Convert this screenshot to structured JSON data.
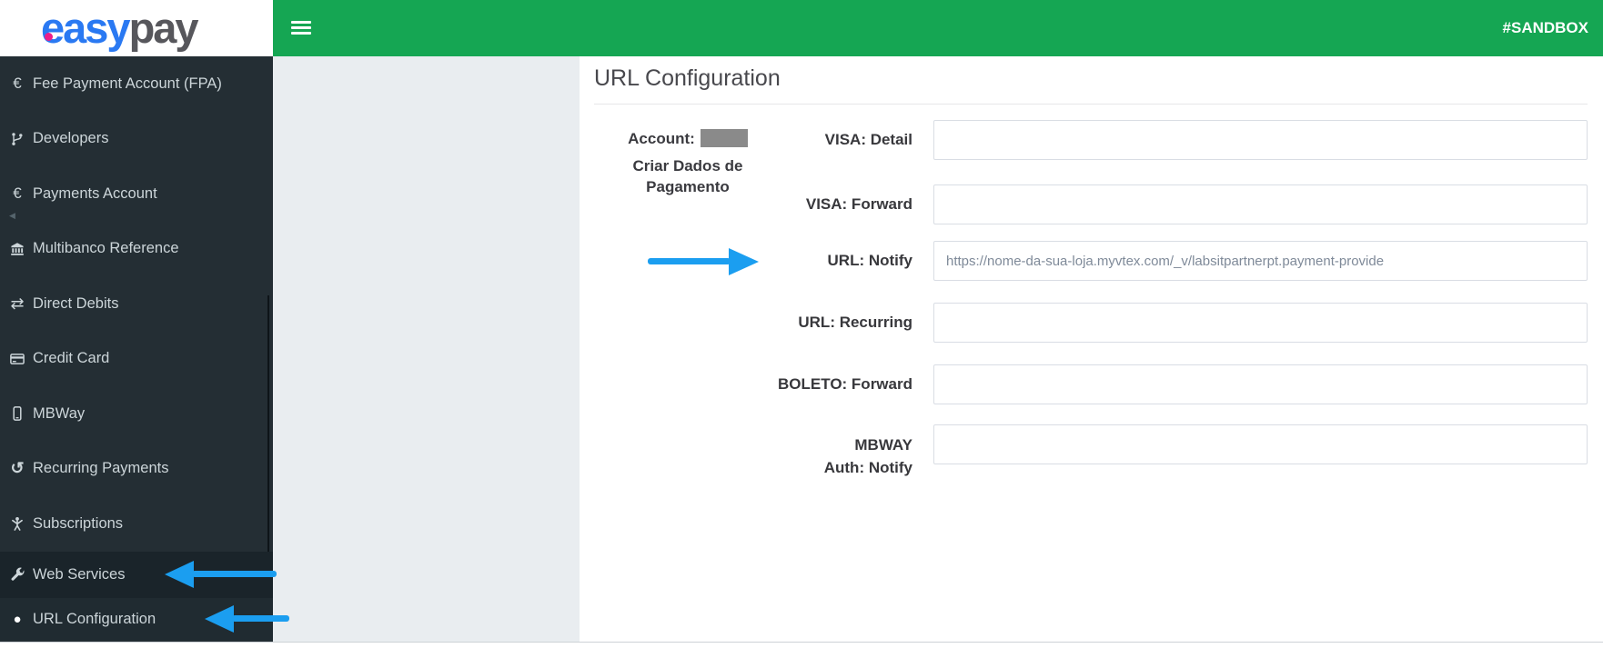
{
  "header": {
    "logo_easy": "easy",
    "logo_pay": "pay",
    "env_badge": "#SANDBOX"
  },
  "sidebar": {
    "items": [
      {
        "icon": "euro-icon",
        "label": "Fee Payment Account (FPA)"
      },
      {
        "icon": "git-branch-icon",
        "label": "Developers"
      },
      {
        "icon": "euro-icon",
        "label": "Payments Account",
        "collapse_caret": "◀"
      },
      {
        "icon": "bank-icon",
        "label": "Multibanco Reference"
      },
      {
        "icon": "transfer-icon",
        "label": "Direct Debits"
      },
      {
        "icon": "credit-card-icon",
        "label": "Credit Card"
      },
      {
        "icon": "mobile-icon",
        "label": "MBWay"
      },
      {
        "icon": "history-icon",
        "label": "Recurring Payments"
      },
      {
        "icon": "person-icon",
        "label": "Subscriptions"
      },
      {
        "icon": "wrench-icon",
        "label": "Web Services",
        "active": true
      },
      {
        "icon": "circle-icon",
        "label": "URL Configuration",
        "active": true
      }
    ],
    "glyphs": {
      "euro": "€",
      "transfer": "⇄",
      "history": "↺",
      "circle": "●",
      "caret": "◀"
    }
  },
  "main": {
    "title": "URL Configuration",
    "account": {
      "label": "Account:",
      "description": "Criar Dados de Pagamento"
    },
    "form": {
      "rows": [
        {
          "label": "VISA: Detail",
          "value": ""
        },
        {
          "label": "VISA: Forward",
          "value": ""
        },
        {
          "label": "URL: Notify",
          "value": "https://nome-da-sua-loja.myvtex.com/_v/labsitpartnerpt.payment-provide"
        },
        {
          "label": "URL: Recurring",
          "value": ""
        },
        {
          "label": "BOLETO: Forward",
          "value": ""
        },
        {
          "label": "MBWAY Auth: Notify",
          "value": ""
        }
      ]
    }
  },
  "annotations": {
    "arrows": [
      {
        "target": "sidebar-item-web-services",
        "direction": "left"
      },
      {
        "target": "sidebar-item-url-configuration",
        "direction": "left"
      },
      {
        "target": "url-notify-field",
        "direction": "right"
      }
    ],
    "arrow_color": "#1b9ef0"
  },
  "colors": {
    "header_green": "#15a653",
    "sidebar_bg": "#242e34",
    "sidebar_active_bg": "#1a242a",
    "logo_blue": "#2a79f2",
    "logo_gray": "#57575c",
    "logo_dot_pink": "#ec1e8a",
    "redacted_gray": "#8a8a8a",
    "panel_gray": "#e9edf0"
  }
}
